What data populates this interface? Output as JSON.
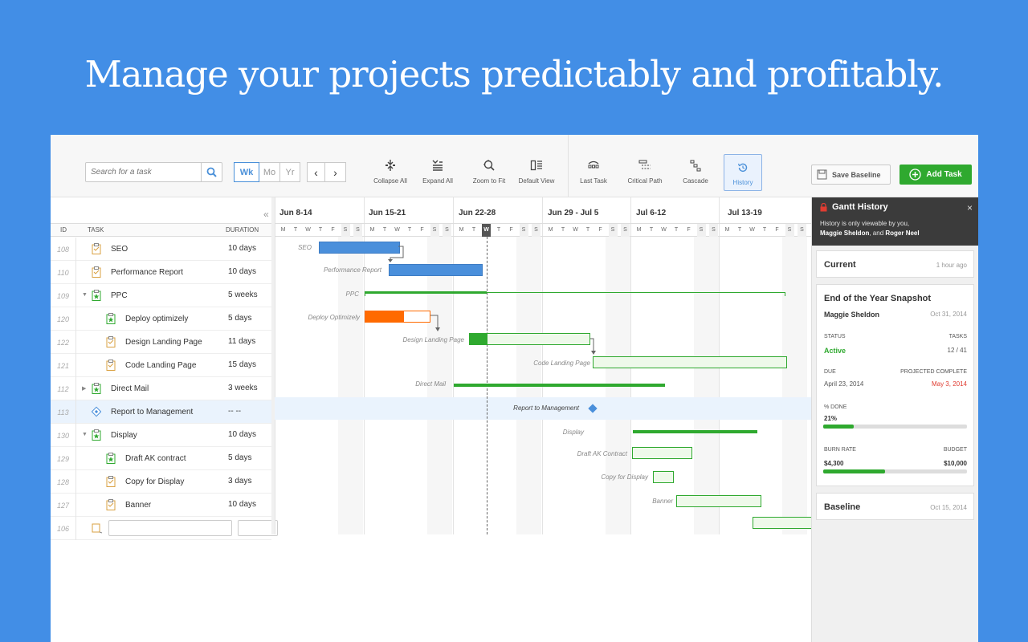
{
  "hero": {
    "headline": "Manage your projects predictably and profitably."
  },
  "toolbar": {
    "search_placeholder": "Search for a task",
    "zoom": {
      "wk": "Wk",
      "mo": "Mo",
      "yr": "Yr",
      "selected": "Wk"
    },
    "prev": "‹",
    "next": "›",
    "buttons": {
      "collapse_all": "Collapse All",
      "expand_all": "Expand All",
      "zoom_to_fit": "Zoom to Fit",
      "default_view": "Default View",
      "last_task": "Last Task",
      "critical_path": "Critical Path",
      "cascade": "Cascade",
      "history": "History"
    },
    "save_baseline": "Save Baseline",
    "add_task": "Add Task",
    "accent_color": "#4a90d9",
    "add_color": "#2fa92f"
  },
  "grid": {
    "headers": {
      "id": "ID",
      "task": "TASK",
      "duration": "DURATION"
    },
    "collapse_glyph": "«",
    "rows": [
      {
        "id": "108",
        "name": "SEO",
        "duration": "10 days",
        "icon": "clipboard-icon",
        "level": 0
      },
      {
        "id": "110",
        "name": "Performance Report",
        "duration": "10 days",
        "icon": "clipboard-icon",
        "level": 0
      },
      {
        "id": "109",
        "name": "PPC",
        "duration": "5 weeks",
        "icon": "folder-star-icon",
        "level": 0,
        "expanded": true
      },
      {
        "id": "120",
        "name": "Deploy optimizely",
        "duration": "5 days",
        "icon": "folder-star-icon",
        "level": 1
      },
      {
        "id": "122",
        "name": "Design Landing Page",
        "duration": "11 days",
        "icon": "clipboard-icon",
        "level": 1
      },
      {
        "id": "121",
        "name": "Code Landing Page",
        "duration": "15 days",
        "icon": "clipboard-icon",
        "level": 1
      },
      {
        "id": "112",
        "name": "Direct Mail",
        "duration": "3 weeks",
        "icon": "folder-star-icon",
        "level": 0,
        "collapsed": true
      },
      {
        "id": "113",
        "name": "Report to Management",
        "duration": "--  --",
        "icon": "milestone-icon",
        "level": 0,
        "highlighted": true
      },
      {
        "id": "130",
        "name": "Display",
        "duration": "10 days",
        "icon": "folder-star-icon",
        "level": 0,
        "expanded": true
      },
      {
        "id": "129",
        "name": "Draft AK contract",
        "duration": "5 days",
        "icon": "folder-star-icon",
        "level": 1
      },
      {
        "id": "128",
        "name": "Copy for Display",
        "duration": "3 days",
        "icon": "clipboard-icon",
        "level": 1
      },
      {
        "id": "127",
        "name": "Banner",
        "duration": "10 days",
        "icon": "clipboard-icon",
        "level": 1
      },
      {
        "id": "106",
        "name": "",
        "duration": "",
        "icon": "new-task-icon",
        "level": 0,
        "new": true
      }
    ]
  },
  "gantt": {
    "weeks": [
      "Jun 8-14",
      "Jun 15-21",
      "Jun 22-28",
      "Jun 29 - Jul 5",
      "Jul 6-12",
      "Jul 13-19"
    ],
    "day_letters": [
      "M",
      "T",
      "W",
      "T",
      "F",
      "S",
      "S"
    ],
    "today_letter": "W",
    "bar_labels": {
      "seo": "SEO",
      "perf": "Performance Report",
      "ppc": "PPC",
      "deploy": "Deploy Optimizely",
      "design": "Design Landing Page",
      "code": "Code Landing Page",
      "direct": "Direct Mail",
      "report": "Report to Management",
      "display": "Display",
      "draft": "Draft AK Contract",
      "copy": "Copy for Display",
      "banner": "Banner"
    },
    "colors": {
      "blue": "#4a8fdb",
      "green": "#2fa92f",
      "orange": "#ff6a00",
      "light_green": "#eef9ea"
    }
  },
  "history": {
    "title": "Gantt History",
    "sub_line1": "History is only viewable by you,",
    "sub_names": "Maggie Sheldon",
    "sub_and": ", and ",
    "sub_names2": "Roger Neel",
    "close": "×",
    "current": {
      "label": "Current",
      "time": "1 hour ago"
    },
    "snapshot": {
      "title": "End of the Year Snapshot",
      "author": "Maggie Sheldon",
      "date": "Oct 31, 2014",
      "status_label": "STATUS",
      "status": "Active",
      "tasks_label": "TASKS",
      "tasks": "12 / 41",
      "due_label": "DUE",
      "due": "April 23, 2014",
      "projected_label": "PROJECTED COMPLETE",
      "projected": "May 3, 2014",
      "done_label": "% DONE",
      "done": "21%",
      "done_fraction": 0.21,
      "burn_label": "BURN RATE",
      "burn": "$4,300",
      "budget_label": "BUDGET",
      "budget": "$10,000",
      "burn_fraction": 0.43,
      "status_color": "#2fa92f",
      "projected_color": "#e03c31"
    },
    "baseline": {
      "label": "Baseline",
      "time": "Oct 15, 2014"
    }
  }
}
